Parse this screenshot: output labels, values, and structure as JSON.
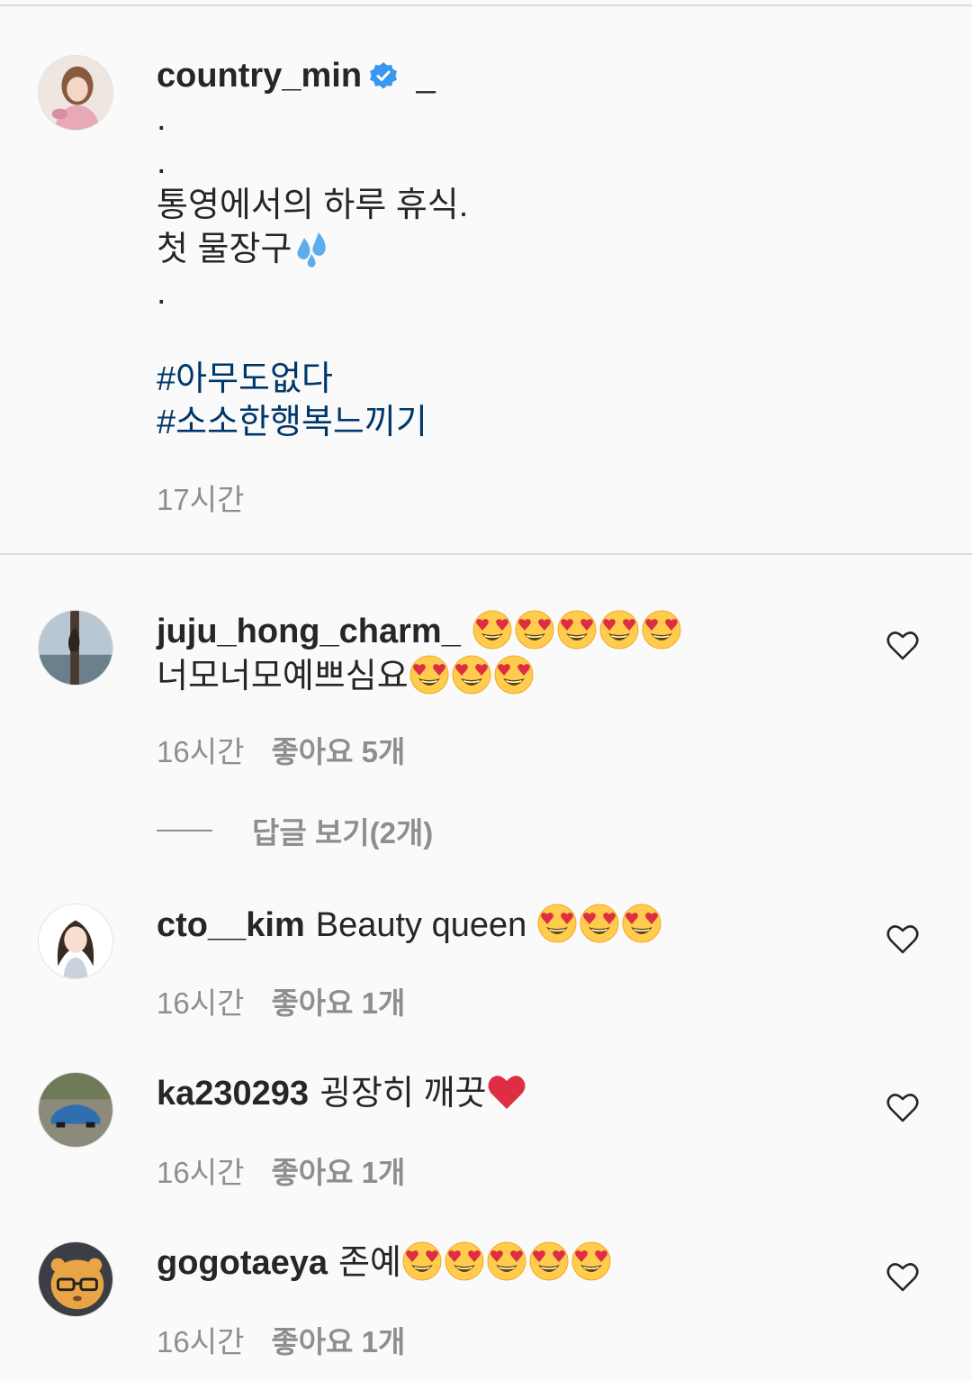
{
  "post": {
    "username": "country_min",
    "verified_icon": "verified-badge-icon",
    "suffix": "_",
    "caption_lines": [
      ".",
      ".",
      "통영에서의 하루 휴식.",
      "첫 물장구",
      "."
    ],
    "caption_emoji": "sweat-droplets-icon",
    "hashtags": [
      "#아무도없다",
      "#소소한행복느끼기"
    ],
    "time": "17시간"
  },
  "comments": [
    {
      "username": "juju_hong_charm_",
      "text_after_emoji": "너모너모예쁘심요",
      "time": "16시간",
      "likes": "좋아요 5개",
      "replies_label": "답글 보기(2개)"
    },
    {
      "username": "cto__kim",
      "text": "Beauty queen",
      "time": "16시간",
      "likes": "좋아요 1개"
    },
    {
      "username": "ka230293",
      "text": "굉장히 깨끗",
      "time": "16시간",
      "likes": "좋아요 1개"
    },
    {
      "username": "gogotaeya",
      "text": "존예",
      "time": "16시간",
      "likes": "좋아요 1개"
    }
  ],
  "colors": {
    "text": "#262626",
    "secondary": "#8e8e8e",
    "hashtag": "#00376b",
    "verified": "#3897f0",
    "divider": "#dbdbdb"
  }
}
